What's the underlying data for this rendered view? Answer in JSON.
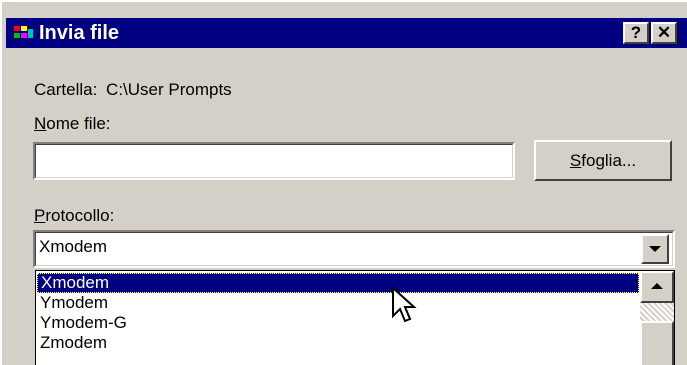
{
  "window": {
    "title": "Invia file",
    "help_button": "?",
    "close_button": "✕"
  },
  "folder": {
    "label": "Cartella:",
    "path": "C:\\User Prompts"
  },
  "filename": {
    "label_access": "N",
    "label_rest": "ome file:",
    "value": ""
  },
  "browse_button": {
    "label_access": "S",
    "label_rest": "foglia..."
  },
  "protocol": {
    "label_access": "P",
    "label_rest": "rotocollo:",
    "selected": "Xmodem",
    "options": [
      "Xmodem",
      "Ymodem",
      "Ymodem-G",
      "Zmodem"
    ]
  },
  "colors": {
    "titlebar": "#000080",
    "dialog_face": "#d4d0c8",
    "selection": "#000080"
  },
  "icons": [
    "app-icon",
    "help-icon",
    "close-icon",
    "chevron-down-icon",
    "scroll-up-icon",
    "mouse-cursor-icon"
  ]
}
